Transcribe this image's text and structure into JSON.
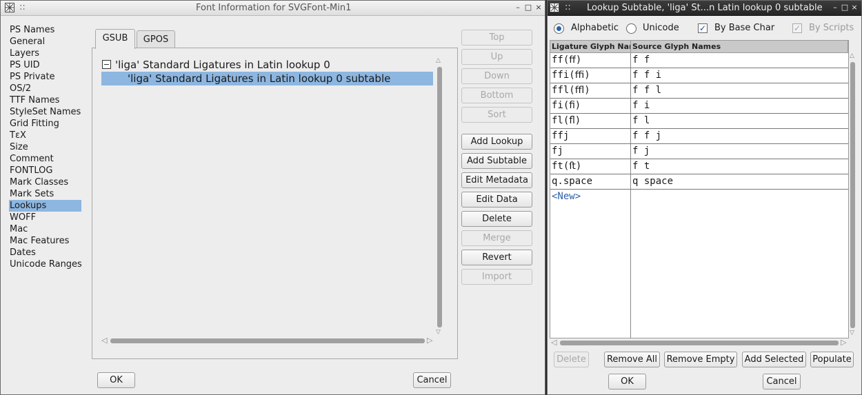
{
  "font_info_window": {
    "title": "Font Information for SVGFont-Min1",
    "titlebar_buttons": [
      "–",
      "□",
      "×"
    ],
    "categories": [
      {
        "label": "PS Names",
        "selected": false
      },
      {
        "label": "General",
        "selected": false
      },
      {
        "label": "Layers",
        "selected": false
      },
      {
        "label": "PS UID",
        "selected": false
      },
      {
        "label": "PS Private",
        "selected": false
      },
      {
        "label": "OS/2",
        "selected": false
      },
      {
        "label": "TTF Names",
        "selected": false
      },
      {
        "label": "StyleSet Names",
        "selected": false
      },
      {
        "label": "Grid Fitting",
        "selected": false
      },
      {
        "label": "TεX",
        "selected": false
      },
      {
        "label": "Size",
        "selected": false
      },
      {
        "label": "Comment",
        "selected": false
      },
      {
        "label": "FONTLOG",
        "selected": false
      },
      {
        "label": "Mark Classes",
        "selected": false
      },
      {
        "label": "Mark Sets",
        "selected": false
      },
      {
        "label": "Lookups",
        "selected": true
      },
      {
        "label": "WOFF",
        "selected": false
      },
      {
        "label": "Mac",
        "selected": false
      },
      {
        "label": "Mac Features",
        "selected": false
      },
      {
        "label": "Dates",
        "selected": false
      },
      {
        "label": "Unicode Ranges",
        "selected": false
      }
    ],
    "tabs": [
      {
        "label": "GSUB",
        "active": true
      },
      {
        "label": "GPOS",
        "active": false
      }
    ],
    "lookup_tree": {
      "lookup": "'liga' Standard Ligatures in Latin lookup 0",
      "subtable": "'liga' Standard Ligatures in Latin lookup 0 subtable"
    },
    "side_buttons": [
      {
        "label": "Top",
        "enabled": false
      },
      {
        "label": "Up",
        "enabled": false
      },
      {
        "label": "Down",
        "enabled": false
      },
      {
        "label": "Bottom",
        "enabled": false
      },
      {
        "label": "Sort",
        "enabled": false
      },
      {
        "label": "Add Lookup",
        "enabled": true
      },
      {
        "label": "Add Subtable",
        "enabled": true
      },
      {
        "label": "Edit Metadata",
        "enabled": true
      },
      {
        "label": "Edit Data",
        "enabled": true
      },
      {
        "label": "Delete",
        "enabled": true
      },
      {
        "label": "Merge",
        "enabled": false
      },
      {
        "label": "Revert",
        "enabled": true
      },
      {
        "label": "Import",
        "enabled": false
      }
    ],
    "ok_label": "OK",
    "cancel_label": "Cancel"
  },
  "subtable_window": {
    "title": "Lookup Subtable, 'liga' St...n Latin lookup 0 subtable",
    "titlebar_buttons": [
      "–",
      "□",
      "×"
    ],
    "options": {
      "alphabetic": "Alphabetic",
      "unicode": "Unicode",
      "by_base_char": "By Base Char",
      "by_scripts": "By Scripts",
      "check_mark": "✓"
    },
    "columns": [
      "Ligature Glyph Name",
      "Source Glyph Names"
    ],
    "rows": [
      {
        "ligature": "ff(ﬀ)",
        "source": "f f"
      },
      {
        "ligature": "ffi(ﬃ)",
        "source": "f f i"
      },
      {
        "ligature": "ffl(ﬄ)",
        "source": "f f l"
      },
      {
        "ligature": "fi(ﬁ)",
        "source": "f i"
      },
      {
        "ligature": "fl(ﬂ)",
        "source": "f l"
      },
      {
        "ligature": "ffj",
        "source": "f f j"
      },
      {
        "ligature": "fj",
        "source": "f j"
      },
      {
        "ligature": "ft(ﬅ)",
        "source": "f t"
      },
      {
        "ligature": "q.space",
        "source": "q space"
      }
    ],
    "new_row_label": "<New>",
    "bottom_buttons": [
      {
        "label": "Delete",
        "enabled": false
      },
      {
        "label": "Remove All",
        "enabled": true
      },
      {
        "label": "Remove Empty",
        "enabled": true
      },
      {
        "label": "Add Selected",
        "enabled": true
      },
      {
        "label": "Populate",
        "enabled": true
      }
    ],
    "ok_label": "OK",
    "cancel_label": "Cancel"
  }
}
